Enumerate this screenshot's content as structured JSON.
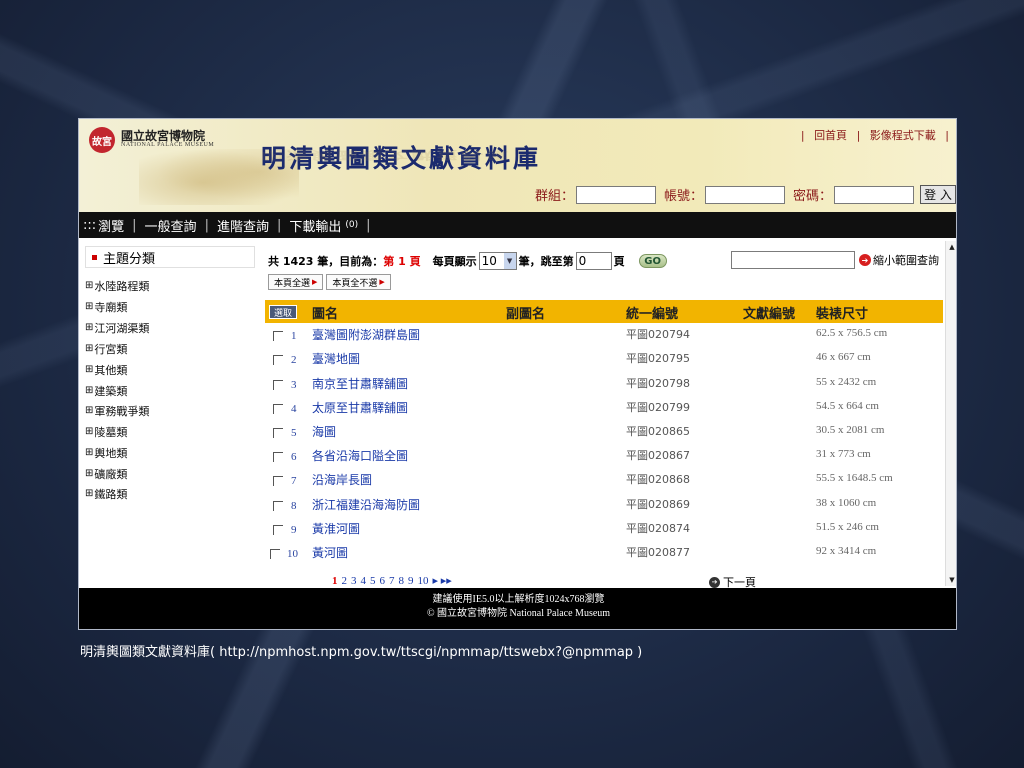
{
  "header": {
    "logo_seal": "故宮",
    "logo_name": "國立故宮博物院",
    "logo_english": "NATIONAL PALACE MUSEUM",
    "site_title": "明清輿圖類文獻資料庫",
    "top_links": [
      "|",
      "回首頁",
      "|",
      "影像程式下載",
      "|"
    ]
  },
  "login": {
    "group_label": "群組：",
    "account_label": "帳號：",
    "password_label": "密碼：",
    "login_button": "登 入"
  },
  "nav": {
    "prefix": ":::",
    "items": [
      "瀏覽",
      "一般查詢",
      "進階查詢",
      "下載輸出"
    ],
    "download_count": "(0)",
    "sep": "|"
  },
  "sidebar": {
    "title": "主題分類",
    "items": [
      "水陸路程類",
      "寺廟類",
      "江河湖渠類",
      "行宮類",
      "其他類",
      "建築類",
      "軍務戰爭類",
      "陵墓類",
      "輿地類",
      "礦廠類",
      "鐵路類"
    ]
  },
  "stats": {
    "prefix": "共 1423 筆，目前為：",
    "current_page": "第 1 頁",
    "per_page_label": "每頁顯示",
    "per_page_value": "10",
    "jump_label": "筆，跳至第",
    "jump_value": "0",
    "page_unit": "頁",
    "go": "GO"
  },
  "narrow_search": {
    "label": "縮小範圍查詢",
    "value": ""
  },
  "select_buttons": {
    "select_all": "本頁全選",
    "deselect_all": "本頁全不選"
  },
  "table": {
    "headers": {
      "select": "選取",
      "name": "圖名",
      "subtitle": "副圖名",
      "uid": "統一編號",
      "doc_id": "文獻編號",
      "size": "裝裱尺寸"
    },
    "rows": [
      {
        "num": "1",
        "name": "臺灣圖附澎湖群島圖",
        "code": "平圖020794",
        "size": "62.5 x 756.5 cm"
      },
      {
        "num": "2",
        "name": "臺灣地圖",
        "code": "平圖020795",
        "size": "46 x 667 cm"
      },
      {
        "num": "3",
        "name": "南京至甘肅驛舖圖",
        "code": "平圖020798",
        "size": "55 x 2432 cm"
      },
      {
        "num": "4",
        "name": "太原至甘肅驛舖圖",
        "code": "平圖020799",
        "size": "54.5 x 664 cm"
      },
      {
        "num": "5",
        "name": "海圖",
        "code": "平圖020865",
        "size": "30.5 x 2081 cm"
      },
      {
        "num": "6",
        "name": "各省沿海口隘全圖",
        "code": "平圖020867",
        "size": "31 x 773 cm"
      },
      {
        "num": "7",
        "name": "沿海岸長圖",
        "code": "平圖020868",
        "size": "55.5 x 1648.5 cm"
      },
      {
        "num": "8",
        "name": "浙江福建沿海海防圖",
        "code": "平圖020869",
        "size": "38 x 1060 cm"
      },
      {
        "num": "9",
        "name": "黃淮河圖",
        "code": "平圖020874",
        "size": "51.5 x 246 cm"
      },
      {
        "num": "10",
        "name": "黃河圖",
        "code": "平圖020877",
        "size": "92 x 3414 cm"
      }
    ]
  },
  "pager": {
    "current": "1",
    "pages": [
      "2",
      "3",
      "4",
      "5",
      "6",
      "7",
      "8",
      "9",
      "10"
    ],
    "more": "▸ ▸▸",
    "next_label": "下一頁"
  },
  "footer": {
    "line1": "建議使用IE5.0以上解析度1024x768瀏覽",
    "line2": "© 國立故宮博物院 National Palace Museum"
  },
  "caption": "明清輿圖類文獻資料庫( http://npmhost.npm.gov.tw/ttscgi/npmmap/ttswebx?@npmmap )"
}
